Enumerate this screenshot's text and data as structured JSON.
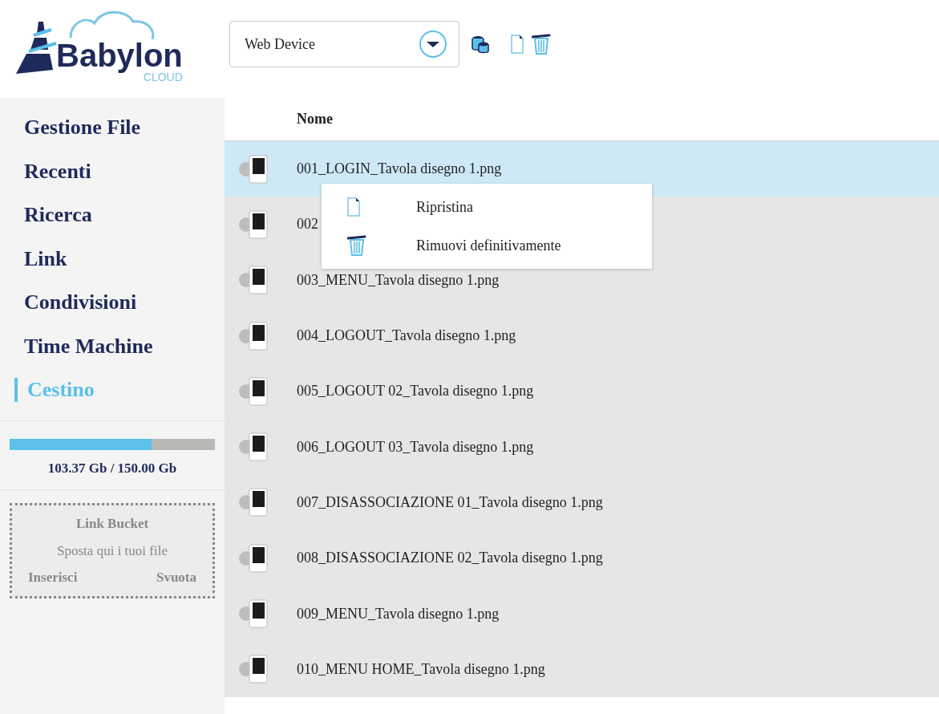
{
  "logo": {
    "name": "Babylon",
    "tagline": "CLOUD"
  },
  "device_select": {
    "value": "Web Device"
  },
  "sidebar": {
    "items": [
      {
        "label": "Gestione File",
        "selected": false
      },
      {
        "label": "Recenti",
        "selected": false
      },
      {
        "label": "Ricerca",
        "selected": false
      },
      {
        "label": "Link",
        "selected": false
      },
      {
        "label": "Condivisioni",
        "selected": false
      },
      {
        "label": "Time Machine",
        "selected": false
      },
      {
        "label": "Cestino",
        "selected": true
      }
    ],
    "storage": {
      "level": 0.69,
      "reading": "103.37 Gb / 150.00 Gb"
    },
    "link_bucket": {
      "title": "Link Bucket",
      "hint": "Sposta qui i tuoi file",
      "actions": [
        "Inserisci",
        "Svuota"
      ]
    }
  },
  "table": {
    "columns": [
      "Nome"
    ],
    "rows": [
      {
        "name": "001_LOGIN_Tavola disegno 1.png",
        "selected": true
      },
      {
        "name": "002",
        "selected": false
      },
      {
        "name": "003_MENU_Tavola disegno 1.png",
        "selected": false
      },
      {
        "name": "004_LOGOUT_Tavola disegno 1.png",
        "selected": false
      },
      {
        "name": "005_LOGOUT 02_Tavola disegno 1.png",
        "selected": false
      },
      {
        "name": "006_LOGOUT 03_Tavola disegno 1.png",
        "selected": false
      },
      {
        "name": "007_DISASSOCIAZIONE 01_Tavola disegno 1.png",
        "selected": false
      },
      {
        "name": "008_DISASSOCIAZIONE 02_Tavola disegno 1.png",
        "selected": false
      },
      {
        "name": "009_MENU_Tavola disegno 1.png",
        "selected": false
      },
      {
        "name": "010_MENU HOME_Tavola disegno 1.png",
        "selected": false
      }
    ]
  },
  "context_menu": {
    "items": [
      {
        "kind": "file",
        "label": "Ripristina"
      },
      {
        "kind": "trash",
        "label": "Rimuovi definitivamente"
      }
    ]
  }
}
